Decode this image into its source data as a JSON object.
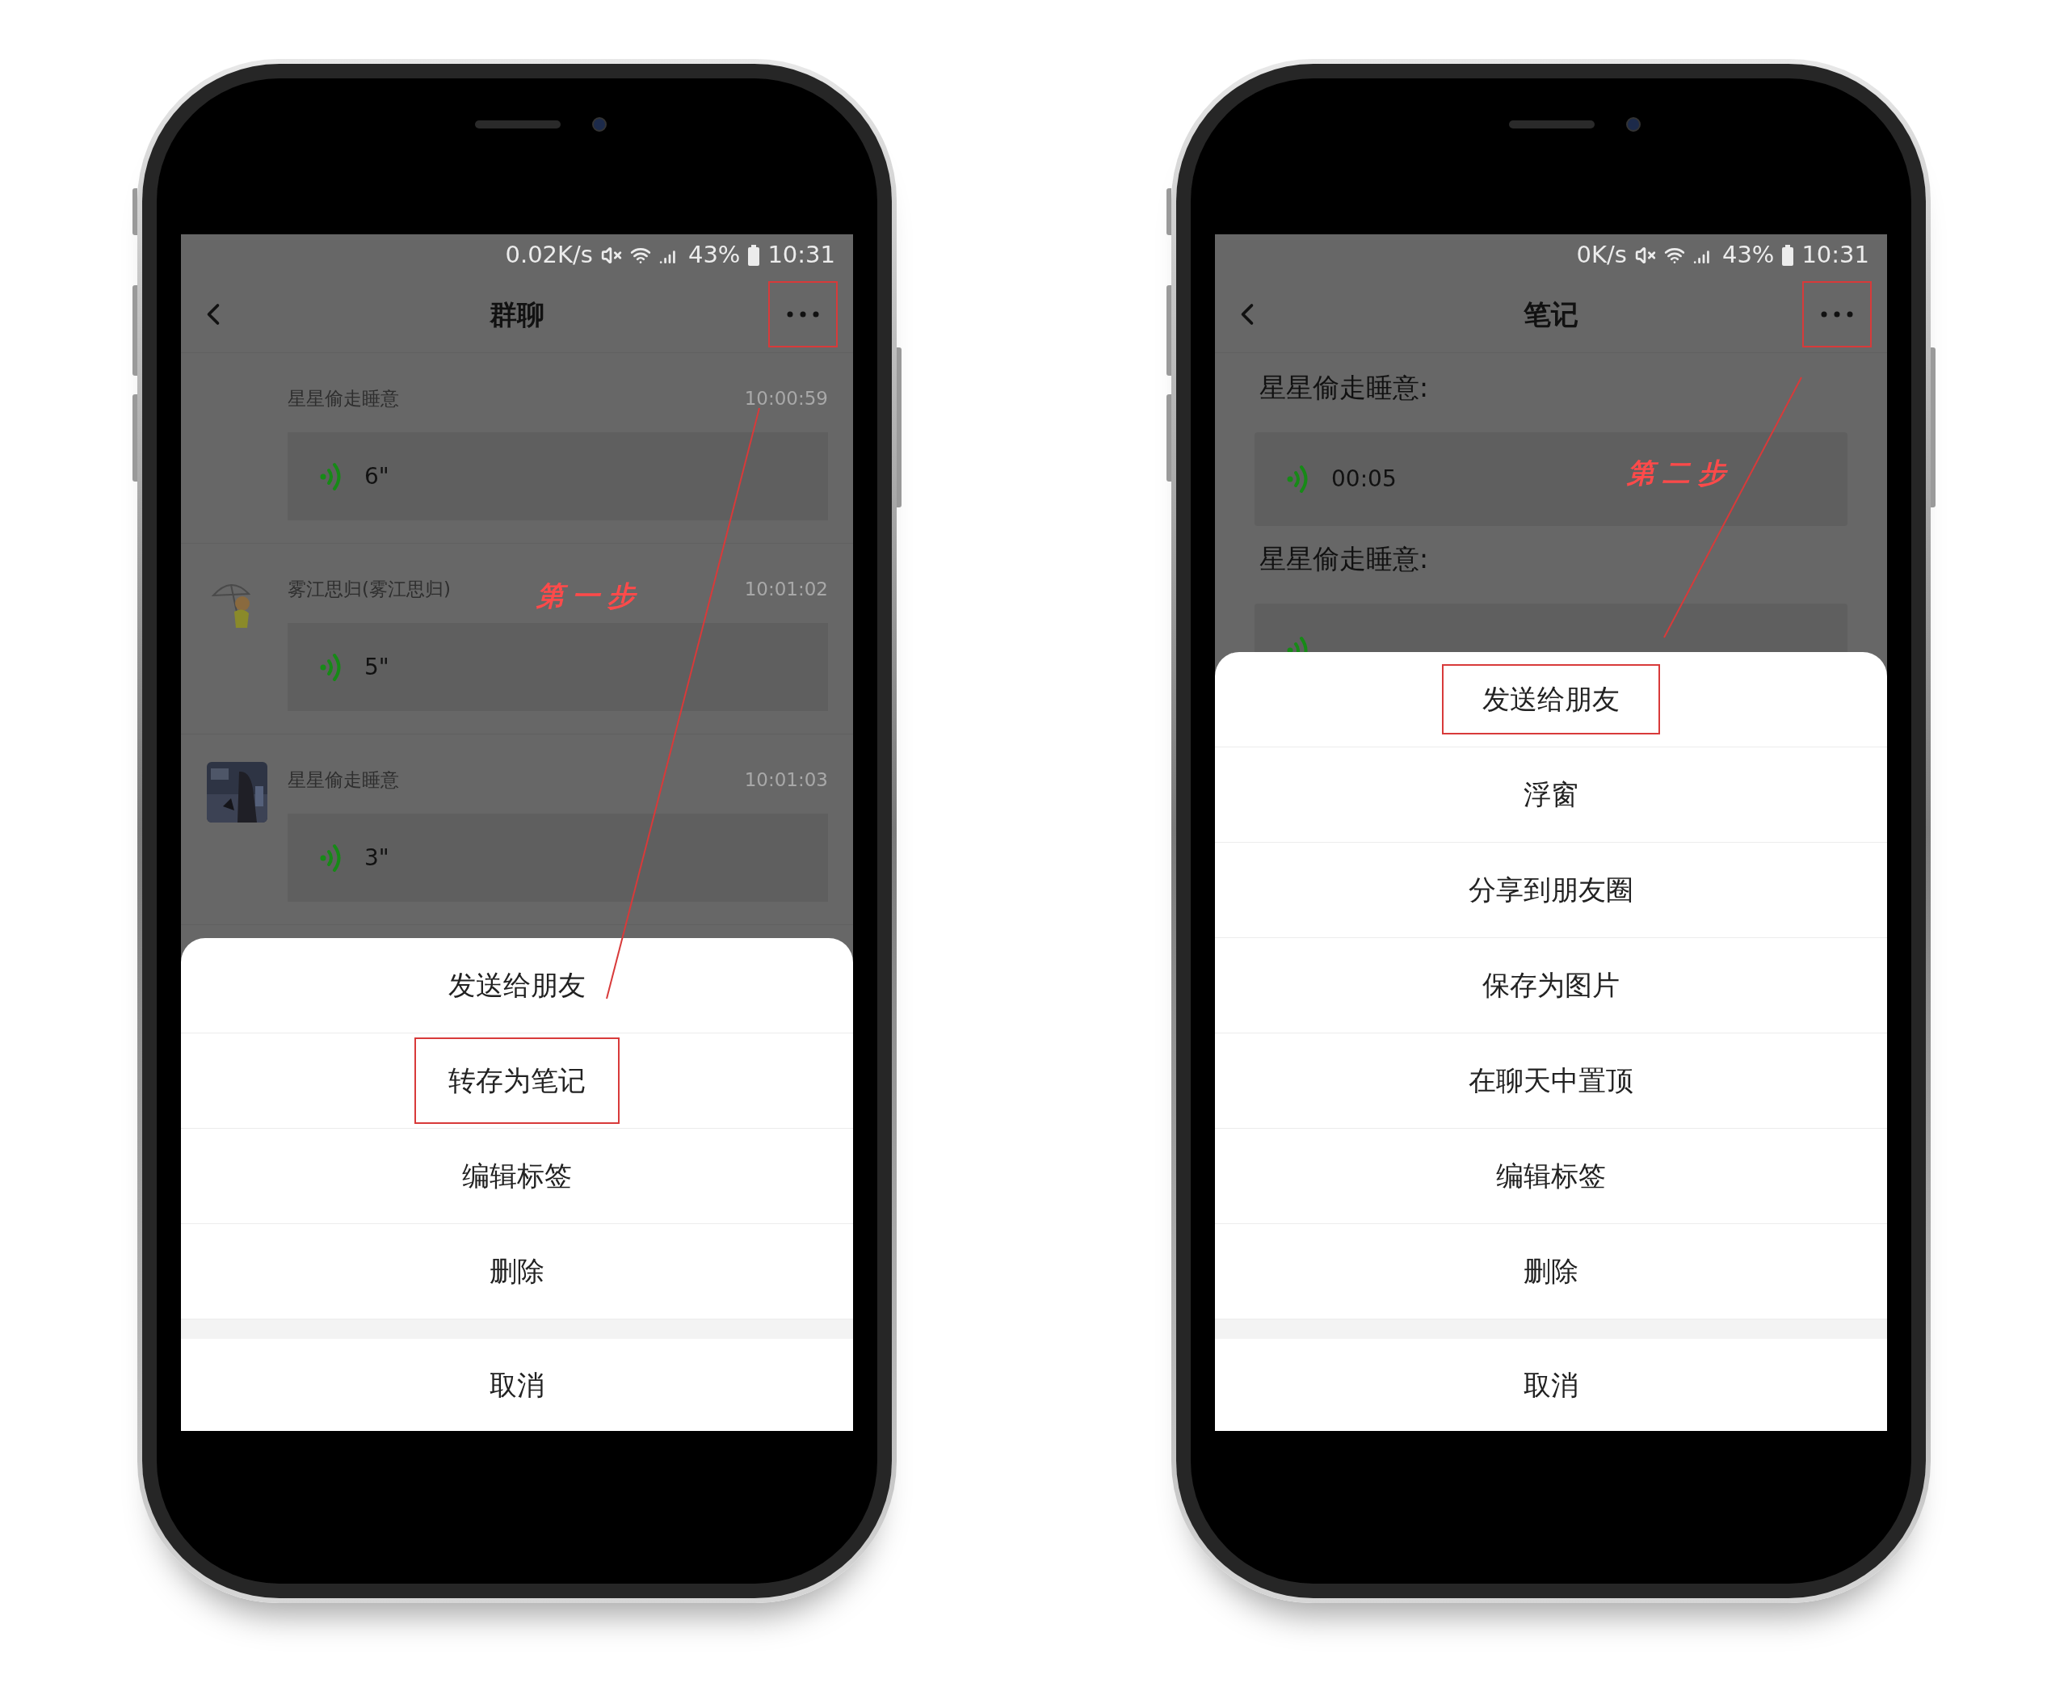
{
  "phones": [
    {
      "status_bar": {
        "speed": "0.02K/s",
        "battery": "43%",
        "time": "10:31"
      },
      "header": {
        "title": "群聊",
        "more_highlighted": true
      },
      "content": {
        "kind": "chat",
        "messages": [
          {
            "sender": "星星偷走睡意",
            "time": "10:00:59",
            "kind": "no-avatar",
            "duration": "6\""
          },
          {
            "sender": "雾江思归(雾江思归)",
            "time": "10:01:02",
            "kind": "figure",
            "duration": "5\""
          },
          {
            "sender": "星星偷走睡意",
            "time": "10:01:03",
            "kind": "picture",
            "duration": "3\""
          }
        ]
      },
      "annotation": {
        "label": "第一步"
      },
      "sheet": {
        "items": [
          {
            "label": "发送给朋友",
            "highlighted": false
          },
          {
            "label": "转存为笔记",
            "highlighted": true
          },
          {
            "label": "编辑标签",
            "highlighted": false
          },
          {
            "label": "删除",
            "highlighted": false
          }
        ],
        "cancel": "取消"
      }
    },
    {
      "status_bar": {
        "speed": "0K/s",
        "battery": "43%",
        "time": "10:31"
      },
      "header": {
        "title": "笔记",
        "more_highlighted": true
      },
      "content": {
        "kind": "note",
        "entries": [
          {
            "author": "星星偷走睡意:",
            "duration": "00:05"
          },
          {
            "author": "星星偷走睡意:"
          }
        ]
      },
      "annotation": {
        "label": "第二步"
      },
      "sheet": {
        "items": [
          {
            "label": "发送给朋友",
            "highlighted": true
          },
          {
            "label": "浮窗",
            "highlighted": false
          },
          {
            "label": "分享到朋友圈",
            "highlighted": false
          },
          {
            "label": "保存为图片",
            "highlighted": false
          },
          {
            "label": "在聊天中置顶",
            "highlighted": false
          },
          {
            "label": "编辑标签",
            "highlighted": false
          },
          {
            "label": "删除",
            "highlighted": false
          }
        ],
        "cancel": "取消"
      }
    }
  ]
}
